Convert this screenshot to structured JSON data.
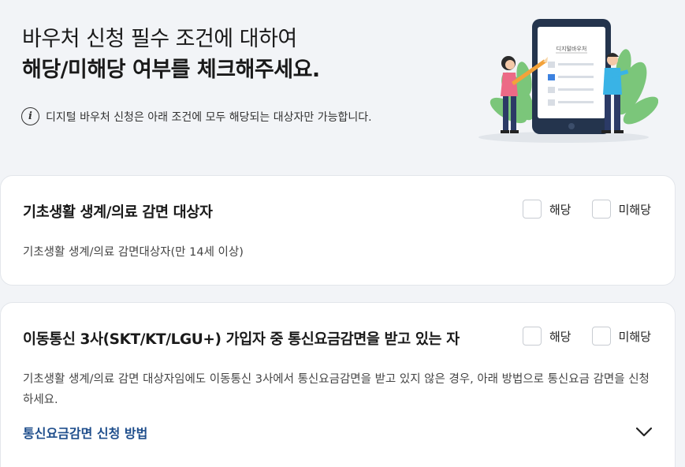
{
  "header": {
    "title_line1": "바우처 신청 필수 조건에 대하여",
    "title_line2": "해당/미해당 여부를 체크해주세요.",
    "notice": "디지털 바우처 신청은 아래 조건에 모두 해당되는 대상자만 가능합니다.",
    "illustration_label": "디지털바우처"
  },
  "options": {
    "yes": "해당",
    "no": "미해당"
  },
  "cards": [
    {
      "title": "기초생활 생계/의료 감면 대상자",
      "description": "기초생활 생계/의료 감면대상자(만 14세 이상)"
    },
    {
      "title": "이동통신 3사(SKT/KT/LGU+) 가입자 중 통신요금감면을 받고 있는 자",
      "description": "기초생활 생계/의료 감면 대상자임에도 이동통신 3사에서 통신요금감면을 받고 있지 않은 경우, 아래 방법으로 통신요금 감면을 신청하세요.",
      "method_link": "통신요금감면 신청 방법"
    }
  ],
  "colors": {
    "background": "#f2f4f7",
    "link": "#1f4e8c",
    "leaf": "#7bc67a",
    "tablet": "#24344d"
  }
}
